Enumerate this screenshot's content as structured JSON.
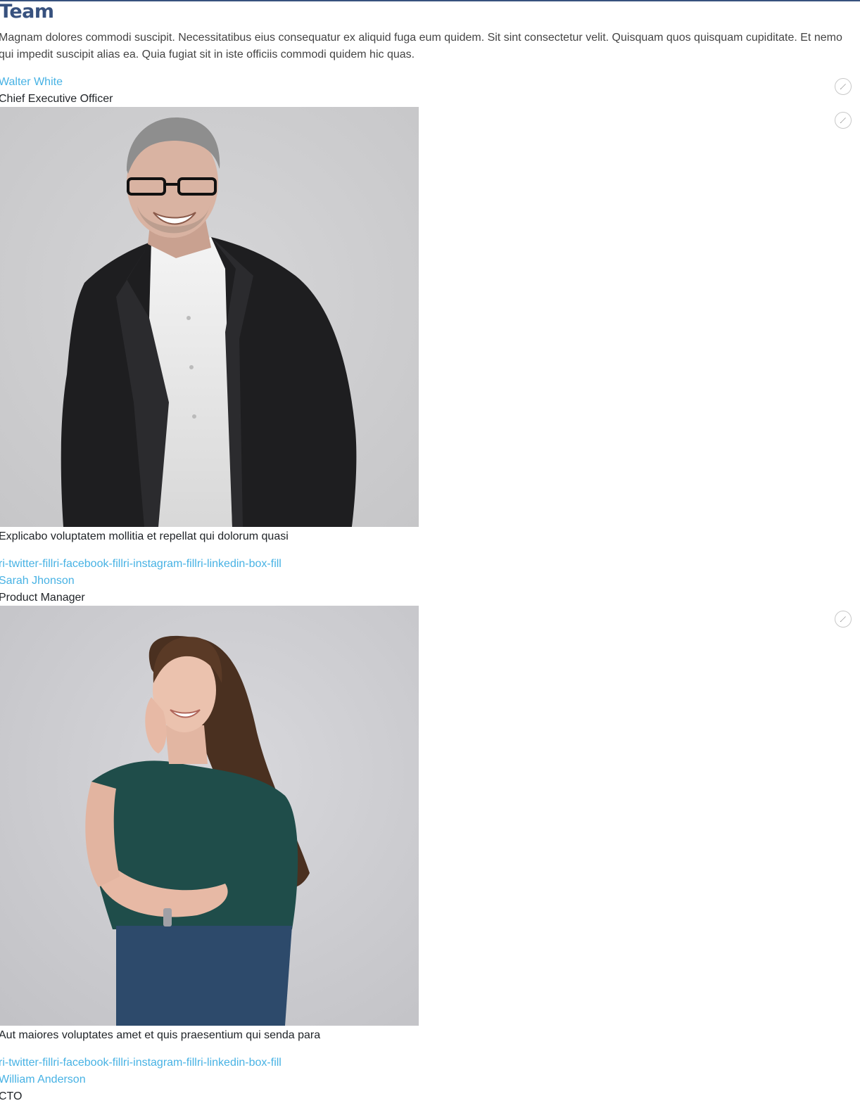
{
  "section": {
    "title": "Team",
    "intro": "Magnam dolores commodi suscipit. Necessitatibus eius consequatur ex aliquid fuga eum quidem. Sit sint consectetur velit. Quisquam quos quisquam cupiditate. Et nemo qui impedit suscipit alias ea. Quia fugiat sit in iste officiis commodi quidem hic quas."
  },
  "colors": {
    "accent": "#47b2e4",
    "heading": "#37517e",
    "text": "#212529"
  },
  "members": [
    {
      "name": "Walter White",
      "role": "Chief Executive Officer",
      "photo": "man-in-black-blazer-portrait",
      "description": "Explicabo voluptatem mollitia et repellat qui dolorum quasi",
      "social": [
        "ri-twitter-fill",
        "ri-facebook-fill",
        "ri-instagram-fill",
        "ri-linkedin-box-fill"
      ]
    },
    {
      "name": "Sarah Jhonson",
      "role": "Product Manager",
      "photo": "woman-in-green-top-portrait",
      "description": "Aut maiores voluptates amet et quis praesentium qui senda para",
      "social": [
        "ri-twitter-fill",
        "ri-facebook-fill",
        "ri-instagram-fill",
        "ri-linkedin-box-fill"
      ]
    },
    {
      "name": "William Anderson",
      "role": "CTO"
    }
  ],
  "edit_icon": "pencil-icon"
}
